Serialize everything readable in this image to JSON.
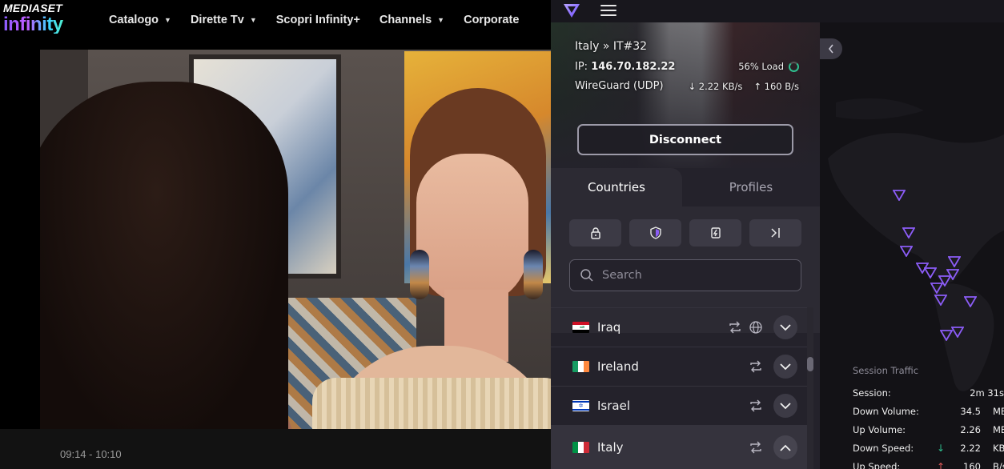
{
  "site": {
    "logo_top": "MEDIASET",
    "logo_bottom": "infinity",
    "nav": [
      {
        "label": "Catalogo",
        "has_caret": true
      },
      {
        "label": "Dirette Tv",
        "has_caret": true
      },
      {
        "label": "Scopri Infinity+",
        "has_caret": false
      },
      {
        "label": "Channels",
        "has_caret": true
      },
      {
        "label": "Corporate",
        "has_caret": false
      }
    ],
    "timecode": "09:14 - 10:10"
  },
  "vpn": {
    "connection": {
      "server": "Italy » IT#32",
      "ip_label": "IP:",
      "ip": "146.70.182.22",
      "load": "56% Load",
      "protocol": "WireGuard (UDP)",
      "download": "2.22 KB/s",
      "upload": "160 B/s",
      "disconnect_label": "Disconnect"
    },
    "tabs": [
      {
        "label": "Countries",
        "active": true
      },
      {
        "label": "Profiles",
        "active": false
      }
    ],
    "filters": [
      {
        "icon": "lock-icon"
      },
      {
        "icon": "shield-icon"
      },
      {
        "icon": "tor-icon"
      },
      {
        "icon": "secure-core-icon"
      }
    ],
    "search_placeholder": "Search",
    "countries": [
      {
        "name": "Iraq",
        "flag": "iraq",
        "icons": [
          "p2p-icon",
          "tor-icon"
        ],
        "expanded": false,
        "selected": false
      },
      {
        "name": "Ireland",
        "flag": "ireland",
        "icons": [
          "p2p-icon"
        ],
        "expanded": false,
        "selected": false
      },
      {
        "name": "Israel",
        "flag": "israel",
        "icons": [
          "p2p-icon"
        ],
        "expanded": false,
        "selected": false
      },
      {
        "name": "Italy",
        "flag": "italy",
        "icons": [
          "p2p-icon"
        ],
        "expanded": true,
        "selected": true
      }
    ],
    "traffic": {
      "title": "Session Traffic",
      "rows": [
        {
          "label": "Session:",
          "value": "2m 31s",
          "unit": "",
          "arrow": ""
        },
        {
          "label": "Down Volume:",
          "value": "34.5",
          "unit": "MB",
          "arrow": ""
        },
        {
          "label": "Up Volume:",
          "value": "2.26",
          "unit": "MB",
          "arrow": ""
        },
        {
          "label": "Down Speed:",
          "value": "2.22",
          "unit": "KB/s",
          "arrow": "↓"
        },
        {
          "label": "Up Speed:",
          "value": "160",
          "unit": "B/s",
          "arrow": "↑"
        }
      ]
    },
    "colors": {
      "accent": "#8b5cf6",
      "panel": "#24222b",
      "map_bg": "#131216",
      "load_ring": "#2fbf8f",
      "down_arrow": "#2fbf8f",
      "up_arrow": "#e05a5a"
    }
  }
}
